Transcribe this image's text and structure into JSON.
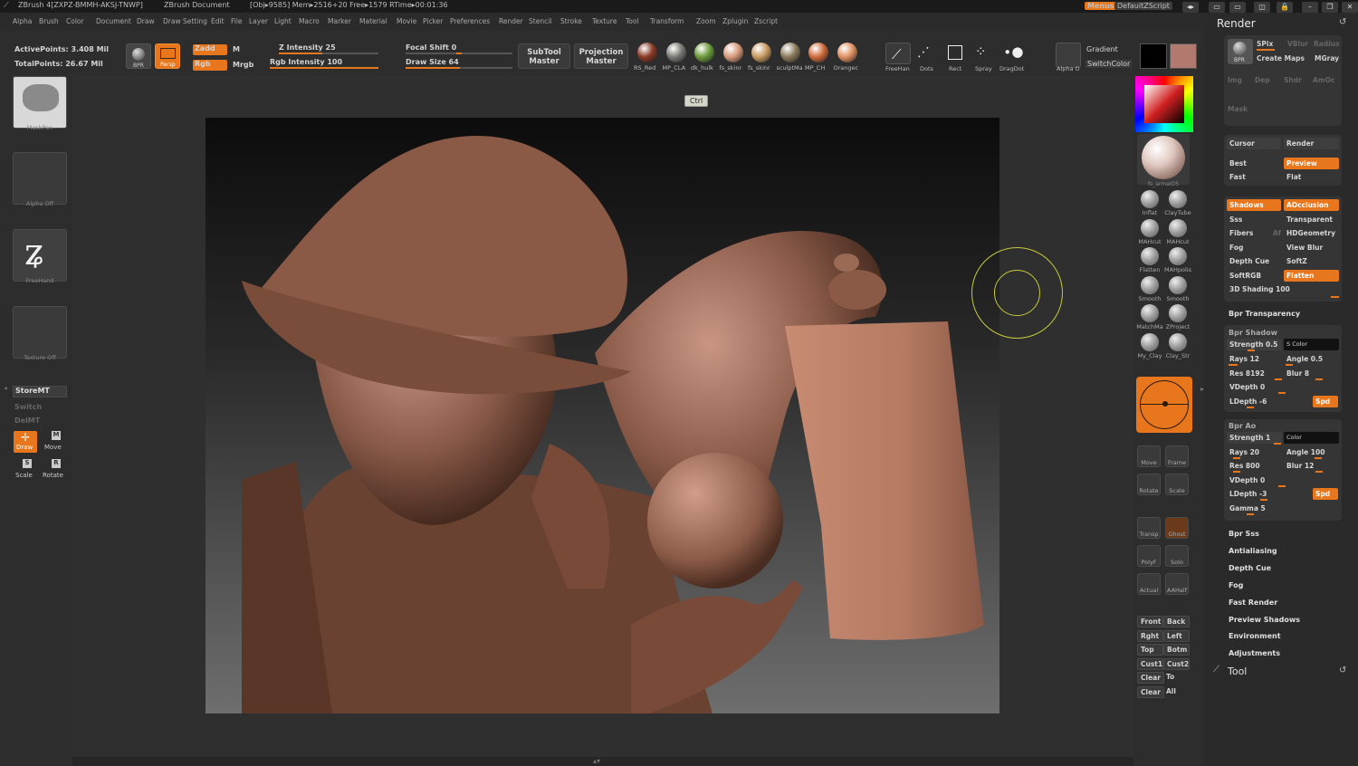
{
  "titlebar": {
    "app": "ZBrush 4[ZXPZ-BMMH-AKSJ-TNWP]",
    "document": "ZBrush Document",
    "stats": "[Obj▸9585] Mem▸2516+20 Free▸1579 RTime▸00:01:36",
    "menus_btn": "Menus",
    "script_btn": "DefaultZScript"
  },
  "menus": [
    "Alpha",
    "Brush",
    "Color",
    "Document",
    "Draw",
    "Draw Setting",
    "Edit",
    "File",
    "Layer",
    "Light",
    "Macro",
    "Marker",
    "Material",
    "Movie",
    "Picker",
    "Preferences",
    "Render",
    "Stencil",
    "Stroke",
    "Texture",
    "Tool",
    "Transform",
    "Zoom",
    "Zplugin",
    "Zscript"
  ],
  "toolbar": {
    "active_points": "ActivePoints: 3.408 Mil",
    "total_points": "TotalPoints: 26.67 Mil",
    "bpr": "BPR",
    "persp": "Persp",
    "zadd": "Zadd",
    "zsub": "M",
    "rgb": "Rgb",
    "mrgb": "Mrgb",
    "z_intensity": "Z Intensity 25",
    "rgb_intensity": "Rgb Intensity 100",
    "focal_shift": "Focal Shift 0",
    "draw_size": "Draw Size 64",
    "subtool_master_1": "SubTool",
    "subtool_master_2": "Master",
    "projection_master_1": "Projection",
    "projection_master_2": "Master",
    "materials": [
      {
        "label": "RS_Red",
        "color": "#8a3a26"
      },
      {
        "label": "MP_CLA",
        "color": "#7a7a74"
      },
      {
        "label": "dk_hulk",
        "color": "#6b9a3a"
      },
      {
        "label": "fs_skinr",
        "color": "#d89a7a"
      },
      {
        "label": "fs_skinr",
        "color": "#c89a60"
      },
      {
        "label": "sculptMa",
        "color": "#8a7a5a"
      },
      {
        "label": "MP_CH",
        "color": "#d06a3a"
      },
      {
        "label": "Orangec",
        "color": "#e09060"
      }
    ],
    "strokes": [
      "FreeHan",
      "Dots",
      "Rect",
      "Spray",
      "DragDot"
    ],
    "alpha_off": "Alpha O",
    "gradient": "Gradient",
    "switch_color": "SwitchColor",
    "main_color": "#000000",
    "secondary_color": "#b27a6e"
  },
  "tooltip": "Ctrl",
  "left_shelf": {
    "brush": "MaskPen",
    "alpha": "Alpha  Off",
    "stroke": "FreeHand",
    "texture": "Texture  Off",
    "store_mt": "StoreMT",
    "switch": "Switch",
    "del_mt": "DelMT",
    "draw": "Draw",
    "move": "Move",
    "scale": "Scale",
    "rotate": "Rotate"
  },
  "right_shelf": {
    "material_label": "fs_armaID5",
    "brushes": [
      {
        "label": "Inflat"
      },
      {
        "label": "ClayTube"
      },
      {
        "label": "MAHcut"
      },
      {
        "label": "MAHcut"
      },
      {
        "label": "Flatten"
      },
      {
        "label": "MAHpolis"
      },
      {
        "label": "Smooth"
      },
      {
        "label": "Smooth"
      },
      {
        "label": "MatchMa"
      },
      {
        "label": "ZProject"
      },
      {
        "label": "My_Clay"
      },
      {
        "label": "Clay_Str"
      }
    ],
    "nav": [
      {
        "label": "Move"
      },
      {
        "label": "Frame"
      },
      {
        "label": "Rotate"
      },
      {
        "label": "Scale"
      },
      {
        "label": "Transp"
      },
      {
        "label": "Ghost"
      },
      {
        "label": "PolyF"
      },
      {
        "label": "Solo"
      },
      {
        "label": "Actual"
      },
      {
        "label": "AAHalf"
      }
    ],
    "views": [
      [
        "Front",
        "Back"
      ],
      [
        "Rght",
        "Left"
      ],
      [
        "Top",
        "Botm"
      ],
      [
        "Cust1",
        "Cust2"
      ],
      [
        "Clear",
        "To"
      ],
      [
        "Clear",
        "All"
      ]
    ]
  },
  "render_palette": {
    "title": "Render",
    "bpr": "BPR",
    "spix": "SPix",
    "vblur": "VBlur",
    "radius": "Radius",
    "create_maps": "Create Maps",
    "mgray": "MGray",
    "img": "Img",
    "dep": "Dep",
    "shdr": "Shdr",
    "amoc": "AmOc",
    "mask": "Mask",
    "cursor": "Cursor",
    "render_btn": "Render",
    "best": "Best",
    "preview": "Preview",
    "fast": "Fast",
    "flat": "Flat",
    "shadows": "Shadows",
    "aocclusion": "AOcclusion",
    "sss": "Sss",
    "transparent": "Transparent",
    "fibers": "Fibers",
    "af": "Af",
    "hdgeometry": "HDGeometry",
    "fog": "Fog",
    "view_blur": "View Blur",
    "depth_cue": "Depth Cue",
    "softz": "SoftZ",
    "softrgb": "SoftRGB",
    "flatten": "Flatten",
    "shading": "3D Shading 100",
    "bpr_transparency": "Bpr Transparency",
    "bpr_shadow": "Bpr Shadow",
    "shadow": {
      "strength": "Strength 0.5",
      "s_color": "S Color",
      "rays": "Rays 12",
      "angle": "Angle 0.5",
      "res": "Res 8192",
      "blur": "Blur 8",
      "vdepth": "VDepth 0",
      "ldepth": "LDepth -6",
      "spd": "Spd"
    },
    "bpr_ao": "Bpr Ao",
    "ao": {
      "strength": "Strength 1",
      "color": "Color",
      "rays": "Rays 20",
      "angle": "Angle 100",
      "res": "Res 800",
      "blur": "Blur 12",
      "vdepth": "VDepth 0",
      "ldepth": "LDepth -3",
      "spd": "Spd",
      "gamma": "Gamma 5"
    },
    "sections": [
      "Bpr Sss",
      "Antialiasing",
      "Depth Cue",
      "Fog",
      "Fast Render",
      "Preview Shadows",
      "Environment",
      "Adjustments"
    ],
    "tool": "Tool"
  }
}
